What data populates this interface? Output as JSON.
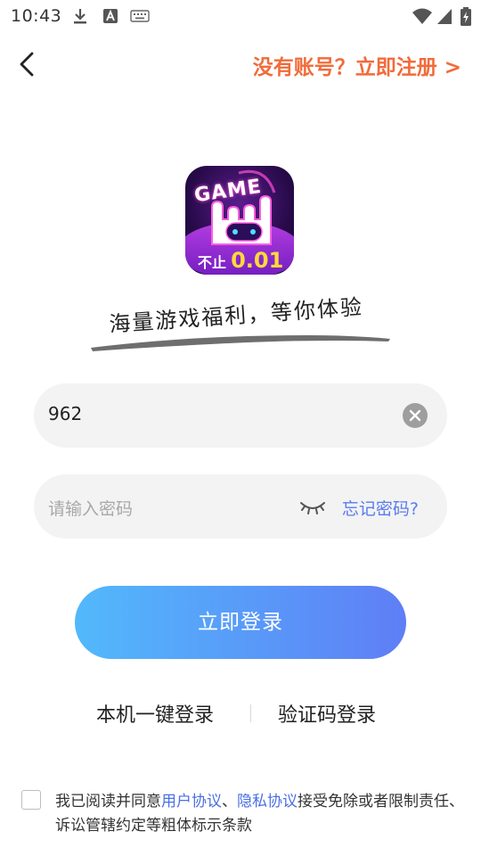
{
  "status_bar": {
    "time": "10:43",
    "icons": [
      "download-icon",
      "font-a-icon",
      "keyboard-icon",
      "wifi-icon",
      "signal-icon",
      "battery-charging-icon"
    ]
  },
  "header": {
    "back_icon": "chevron-left-icon",
    "register_text": "没有账号？立即注册 >"
  },
  "logo": {
    "word": "GAME",
    "caption_prefix": "不止",
    "caption_value": "0.01"
  },
  "slogan": "海量游戏福利，等你体验",
  "account_field": {
    "value": "962",
    "clear_icon": "clear-circle-icon"
  },
  "password_field": {
    "placeholder": "请输入密码",
    "eye_icon": "eye-closed-icon",
    "forgot_label": "忘记密码?"
  },
  "login_button": "立即登录",
  "alt_login": {
    "one_click": "本机一键登录",
    "sms": "验证码登录"
  },
  "agreement": {
    "prefix": "我已阅读并同意",
    "user_agreement": "用户协议",
    "separator": "、",
    "privacy": "隐私协议",
    "suffix": "接受免除或者限制责任、诉讼管辖约定等粗体标示条款"
  },
  "colors": {
    "accent_orange": "#f26b3a",
    "link_blue": "#4a6fe3",
    "button_start": "#52b9fb",
    "button_end": "#5f7ef6"
  }
}
